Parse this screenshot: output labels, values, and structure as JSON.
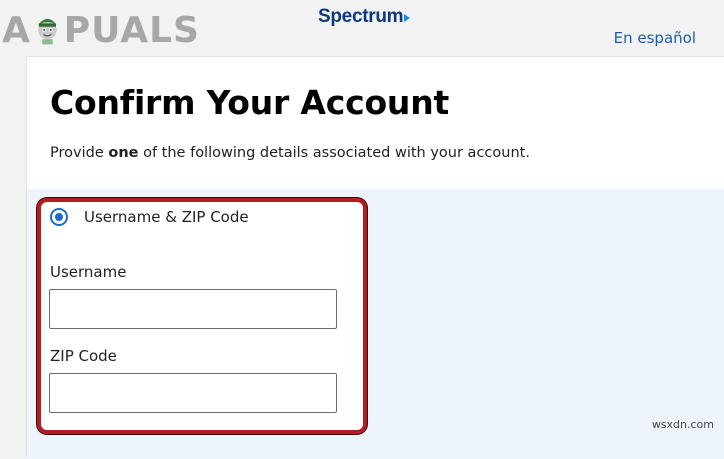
{
  "watermark": {
    "prefix": "A",
    "suffix": "PUALS"
  },
  "header": {
    "brand": "Spectrum",
    "language_link": "En español"
  },
  "card": {
    "title": "Confirm Your Account",
    "subtitle_pre": "Provide ",
    "subtitle_bold": "one",
    "subtitle_post": " of the following details associated with your account."
  },
  "form": {
    "option_label": "Username & ZIP Code",
    "option_selected": true,
    "username_label": "Username",
    "username_value": "",
    "zip_label": "ZIP Code",
    "zip_value": ""
  },
  "footer_watermark": "wsxdn.com",
  "colors": {
    "brand": "#0e3a7a",
    "link": "#1b5ea8",
    "radio": "#1b6ec2",
    "highlight": "#b31d22",
    "panel": "#eef4fb"
  }
}
